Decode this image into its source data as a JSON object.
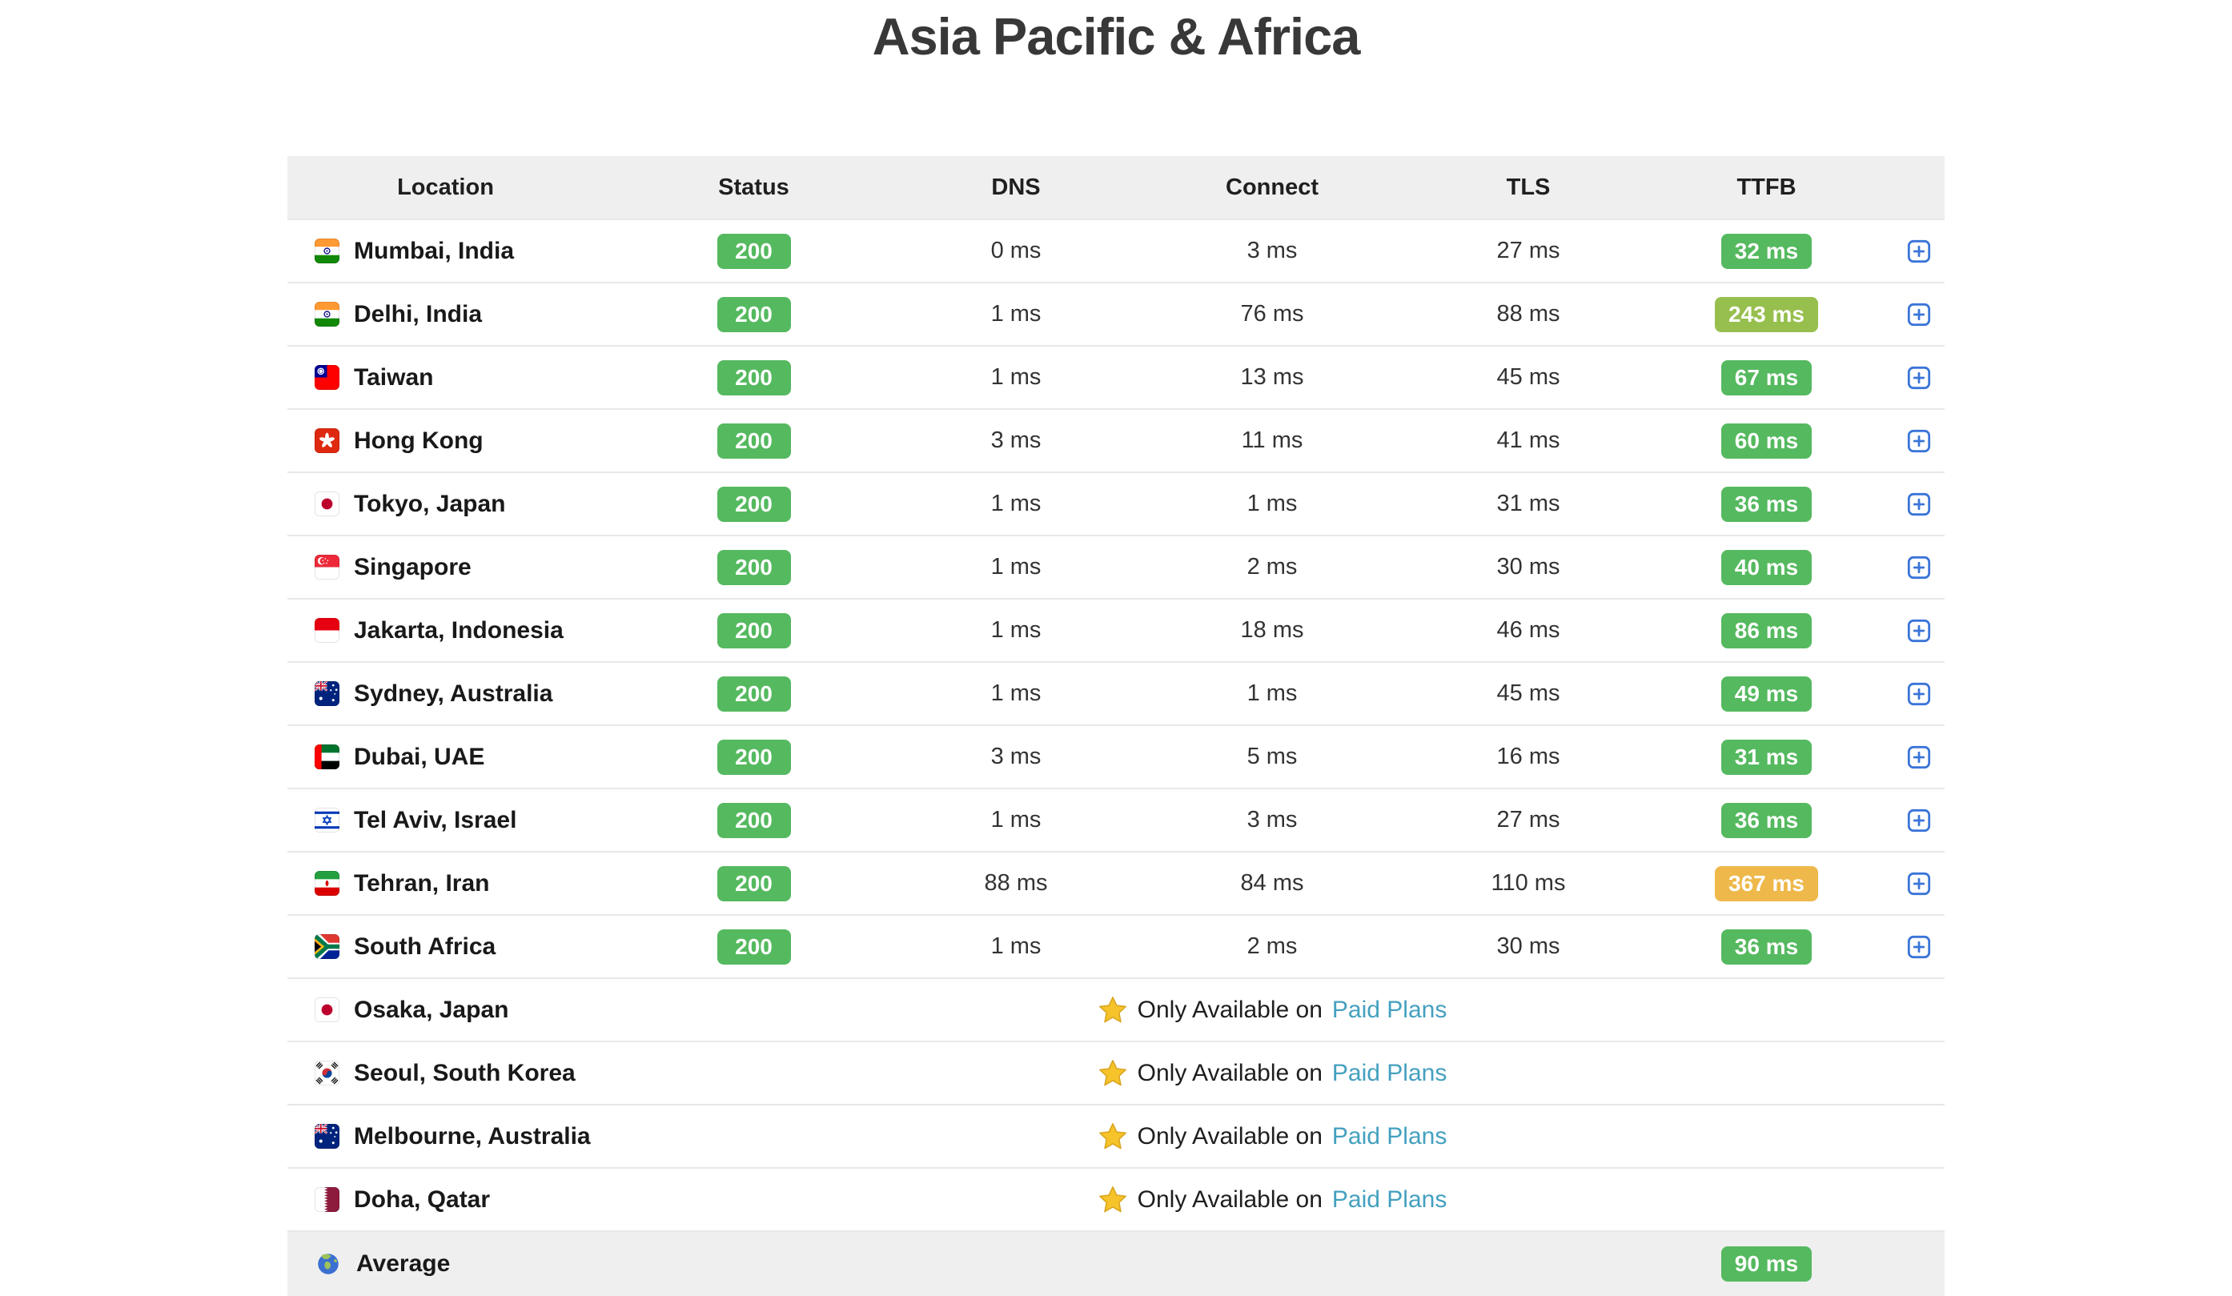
{
  "page": {
    "title": "Asia Pacific & Africa"
  },
  "colors": {
    "green": "#55b95f",
    "ok_green": "#97bf4e",
    "warn_orange": "#eeb84a",
    "link_teal": "#44a0bf",
    "expand_blue": "#3a74d8",
    "header_bg": "#efefef",
    "divider": "#e8e8e8",
    "star_gold": "#f6c32a"
  },
  "icons": {
    "expand_button": "plus-square-icon",
    "paid_star": "star-icon",
    "average_globe": "globe-icon"
  },
  "table": {
    "headers": [
      "Location",
      "Status",
      "DNS",
      "Connect",
      "TLS",
      "TTFB"
    ],
    "paid_note": {
      "prefix": "Only Available on",
      "link_label": "Paid Plans"
    },
    "rows": [
      {
        "type": "metrics",
        "flag": "india",
        "location": "Mumbai, India",
        "status": "200",
        "dns": "0 ms",
        "connect": "3 ms",
        "tls": "27 ms",
        "ttfb": "32 ms",
        "ttfb_level": "good"
      },
      {
        "type": "metrics",
        "flag": "india",
        "location": "Delhi, India",
        "status": "200",
        "dns": "1 ms",
        "connect": "76 ms",
        "tls": "88 ms",
        "ttfb": "243 ms",
        "ttfb_level": "ok"
      },
      {
        "type": "metrics",
        "flag": "taiwan",
        "location": "Taiwan",
        "status": "200",
        "dns": "1 ms",
        "connect": "13 ms",
        "tls": "45 ms",
        "ttfb": "67 ms",
        "ttfb_level": "good"
      },
      {
        "type": "metrics",
        "flag": "hongkong",
        "location": "Hong Kong",
        "status": "200",
        "dns": "3 ms",
        "connect": "11 ms",
        "tls": "41 ms",
        "ttfb": "60 ms",
        "ttfb_level": "good"
      },
      {
        "type": "metrics",
        "flag": "japan",
        "location": "Tokyo, Japan",
        "status": "200",
        "dns": "1 ms",
        "connect": "1 ms",
        "tls": "31 ms",
        "ttfb": "36 ms",
        "ttfb_level": "good"
      },
      {
        "type": "metrics",
        "flag": "singapore",
        "location": "Singapore",
        "status": "200",
        "dns": "1 ms",
        "connect": "2 ms",
        "tls": "30 ms",
        "ttfb": "40 ms",
        "ttfb_level": "good"
      },
      {
        "type": "metrics",
        "flag": "indonesia",
        "location": "Jakarta, Indonesia",
        "status": "200",
        "dns": "1 ms",
        "connect": "18 ms",
        "tls": "46 ms",
        "ttfb": "86 ms",
        "ttfb_level": "good"
      },
      {
        "type": "metrics",
        "flag": "australia",
        "location": "Sydney, Australia",
        "status": "200",
        "dns": "1 ms",
        "connect": "1 ms",
        "tls": "45 ms",
        "ttfb": "49 ms",
        "ttfb_level": "good"
      },
      {
        "type": "metrics",
        "flag": "uae",
        "location": "Dubai, UAE",
        "status": "200",
        "dns": "3 ms",
        "connect": "5 ms",
        "tls": "16 ms",
        "ttfb": "31 ms",
        "ttfb_level": "good"
      },
      {
        "type": "metrics",
        "flag": "israel",
        "location": "Tel Aviv, Israel",
        "status": "200",
        "dns": "1 ms",
        "connect": "3 ms",
        "tls": "27 ms",
        "ttfb": "36 ms",
        "ttfb_level": "good"
      },
      {
        "type": "metrics",
        "flag": "iran",
        "location": "Tehran, Iran",
        "status": "200",
        "dns": "88 ms",
        "connect": "84 ms",
        "tls": "110 ms",
        "ttfb": "367 ms",
        "ttfb_level": "warn"
      },
      {
        "type": "metrics",
        "flag": "southafrica",
        "location": "South Africa",
        "status": "200",
        "dns": "1 ms",
        "connect": "2 ms",
        "tls": "30 ms",
        "ttfb": "36 ms",
        "ttfb_level": "good"
      },
      {
        "type": "paid",
        "flag": "japan",
        "location": "Osaka, Japan"
      },
      {
        "type": "paid",
        "flag": "southkorea",
        "location": "Seoul, South Korea"
      },
      {
        "type": "paid",
        "flag": "australia",
        "location": "Melbourne, Australia"
      },
      {
        "type": "paid",
        "flag": "qatar",
        "location": "Doha, Qatar"
      }
    ],
    "average": {
      "flag": "globe",
      "location_label": "Average",
      "ttfb": "90 ms",
      "ttfb_level": "good"
    }
  }
}
